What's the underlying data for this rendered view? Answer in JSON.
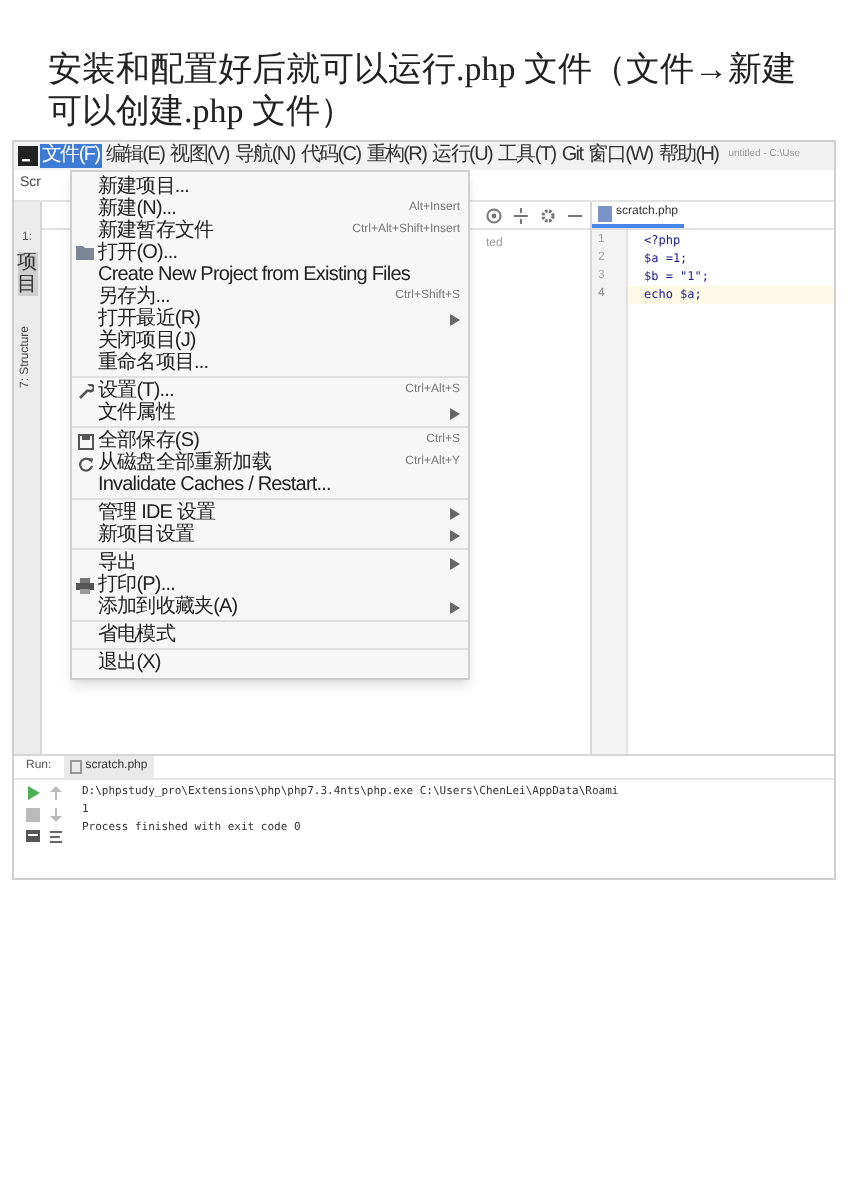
{
  "heading": "安装和配置好后就可以运行.php 文件（文件→新建可以创建.php 文件）",
  "ide": {
    "menubar": [
      {
        "label": "文件(F)",
        "selected": true
      },
      {
        "label": "编辑(E)",
        "selected": false
      },
      {
        "label": "视图(V)",
        "selected": false
      },
      {
        "label": "导航(N)",
        "selected": false
      },
      {
        "label": "代码(C)",
        "selected": false
      },
      {
        "label": "重构(R)",
        "selected": false
      },
      {
        "label": "运行(U)",
        "selected": false
      },
      {
        "label": "工具(T)",
        "selected": false
      },
      {
        "label": "Git",
        "selected": false
      },
      {
        "label": "窗口(W)",
        "selected": false
      },
      {
        "label": "帮助(H)",
        "selected": false
      }
    ],
    "window_title": "untitled - C:\\Use",
    "project_tab": "Scr",
    "side_tabs": {
      "project": "项目",
      "project_number": "1:",
      "structure": "7: Structure"
    },
    "project_text": "ted",
    "file_menu": [
      [
        {
          "kind": "item",
          "label": "新建项目..."
        },
        {
          "kind": "item",
          "label": "新建(N)...",
          "shortcut": "Alt+Insert"
        },
        {
          "kind": "item",
          "label": "新建暂存文件",
          "shortcut": "Ctrl+Alt+Shift+Insert"
        },
        {
          "kind": "folder",
          "label": "打开(O)..."
        },
        {
          "kind": "item",
          "label": "Create New Project from Existing Files"
        },
        {
          "kind": "item",
          "label": "另存为...",
          "shortcut": "Ctrl+Shift+S"
        },
        {
          "kind": "item",
          "label": "打开最近(R)",
          "submenu": true
        },
        {
          "kind": "item",
          "label": "关闭项目(J)"
        },
        {
          "kind": "item",
          "label": "重命名项目..."
        }
      ],
      [
        {
          "kind": "settings",
          "label": "设置(T)...",
          "shortcut": "Ctrl+Alt+S"
        },
        {
          "kind": "item",
          "label": "文件属性",
          "submenu": true
        }
      ],
      [
        {
          "kind": "save",
          "label": "全部保存(S)",
          "shortcut": "Ctrl+S"
        },
        {
          "kind": "reload",
          "label": "从磁盘全部重新加载",
          "shortcut": "Ctrl+Alt+Y"
        },
        {
          "kind": "item",
          "label": "Invalidate Caches / Restart..."
        }
      ],
      [
        {
          "kind": "item",
          "label": "管理 IDE 设置",
          "submenu": true
        },
        {
          "kind": "item",
          "label": "新项目设置",
          "submenu": true
        }
      ],
      [
        {
          "kind": "item",
          "label": "导出",
          "submenu": true
        },
        {
          "kind": "print",
          "label": "打印(P)..."
        },
        {
          "kind": "item",
          "label": "添加到收藏夹(A)",
          "submenu": true
        }
      ],
      [
        {
          "kind": "item",
          "label": "省电模式"
        }
      ],
      [
        {
          "kind": "item",
          "label": "退出(X)"
        }
      ]
    ],
    "editor": {
      "tab": "scratch.php",
      "lines": [
        {
          "number": "1",
          "code": "<?php",
          "current": false
        },
        {
          "number": "2",
          "code": "$a =1;",
          "current": false
        },
        {
          "number": "3",
          "code": "$b = \"1\";",
          "current": false
        },
        {
          "number": "4",
          "code": "echo $a;",
          "current": true
        }
      ]
    },
    "run": {
      "label": "Run:",
      "tab": "scratch.php",
      "output": [
        "D:\\phpstudy_pro\\Extensions\\php\\php7.3.4nts\\php.exe C:\\Users\\ChenLei\\AppData\\Roami",
        "1",
        "Process finished with exit code 0"
      ]
    }
  }
}
